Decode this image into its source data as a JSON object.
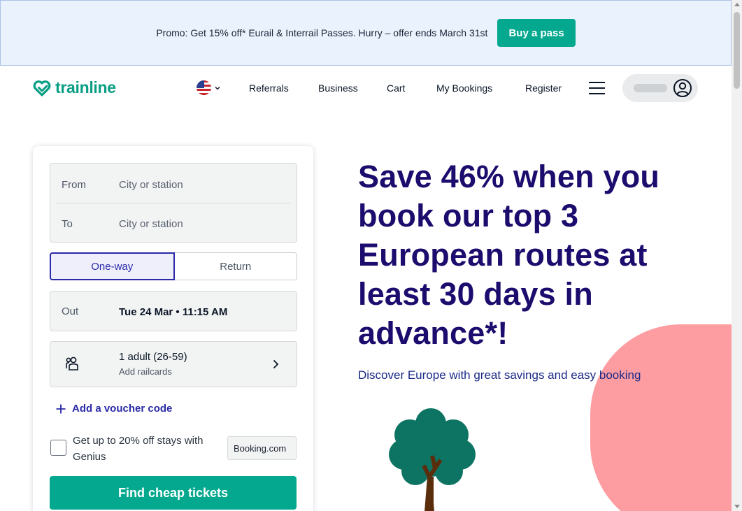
{
  "promo": {
    "text": "Promo: Get 15% off* Eurail & Interrail Passes. Hurry – offer ends March 31st",
    "button": "Buy a pass"
  },
  "nav": {
    "logo": "trainline",
    "links": [
      "Referrals",
      "Business",
      "Cart",
      "My Bookings",
      "Register"
    ],
    "locale_icon": "us-flag-icon",
    "menu_icon": "hamburger-icon",
    "account_icon": "user-circle-icon"
  },
  "search": {
    "from_label": "From",
    "from_placeholder": "City or station",
    "to_label": "To",
    "to_placeholder": "City or station",
    "trip_types": [
      "One-way",
      "Return"
    ],
    "selected_trip_type": "One-way",
    "out_label": "Out",
    "out_value": "Tue 24 Mar • 11:15 AM",
    "passengers": "1 adult (26-59)",
    "railcards": "Add railcards",
    "voucher": "Add a voucher code",
    "genius_text": "Get up to 20% off stays with Genius",
    "genius_checked": false,
    "booking_badge": "Booking.com",
    "submit": "Find cheap tickets"
  },
  "hero": {
    "title": "Save 46% when you book our top 3 European routes at least 30 days in advance*!",
    "subtitle": "Discover Europe with great savings and easy booking"
  },
  "colors": {
    "brand": "#03a88e",
    "hero_text": "#1b0c6d",
    "accent_blue": "#2a2aa8",
    "blob": "#fd9da2"
  }
}
